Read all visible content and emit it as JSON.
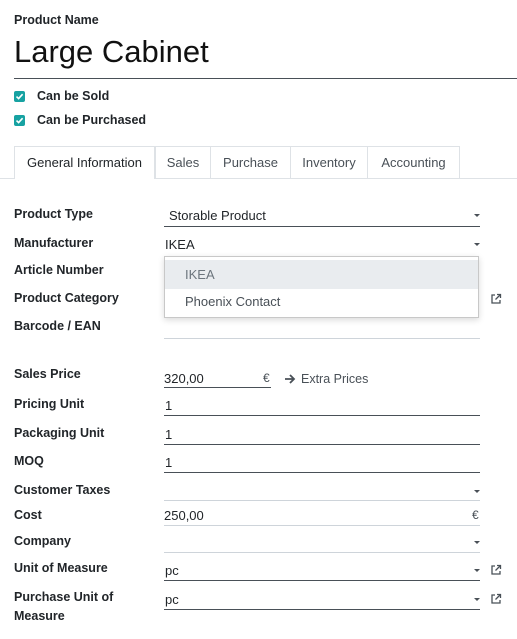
{
  "header": {
    "name_label": "Product Name",
    "product_name": "Large Cabinet",
    "can_be_sold": "Can be Sold",
    "can_be_purchased": "Can be Purchased"
  },
  "tabs": [
    "General Information",
    "Sales",
    "Purchase",
    "Inventory",
    "Accounting"
  ],
  "form": {
    "product_type_label": "Product Type",
    "product_type_value": "Storable Product",
    "manufacturer_label": "Manufacturer",
    "manufacturer_value": "IKEA",
    "article_number_label": "Article Number",
    "product_category_label": "Product Category",
    "barcode_label": "Barcode / EAN",
    "sales_price_label": "Sales Price",
    "sales_price_value": "320,00",
    "currency": "€",
    "extra_prices": "Extra Prices",
    "pricing_unit_label": "Pricing Unit",
    "pricing_unit_value": "1",
    "packaging_unit_label": "Packaging Unit",
    "packaging_unit_value": "1",
    "moq_label": "MOQ",
    "moq_value": "1",
    "customer_taxes_label": "Customer Taxes",
    "cost_label": "Cost",
    "cost_value": "250,00",
    "company_label": "Company",
    "uom_label": "Unit of Measure",
    "uom_value": "pc",
    "purchase_uom_label_1": "Purchase Unit of",
    "purchase_uom_label_2": "Measure",
    "purchase_uom_value": "pc"
  },
  "dropdown": {
    "options": [
      "IKEA",
      "Phoenix Contact"
    ]
  },
  "colors": {
    "checkbox": "#17a2a2",
    "underline": "#495057"
  }
}
